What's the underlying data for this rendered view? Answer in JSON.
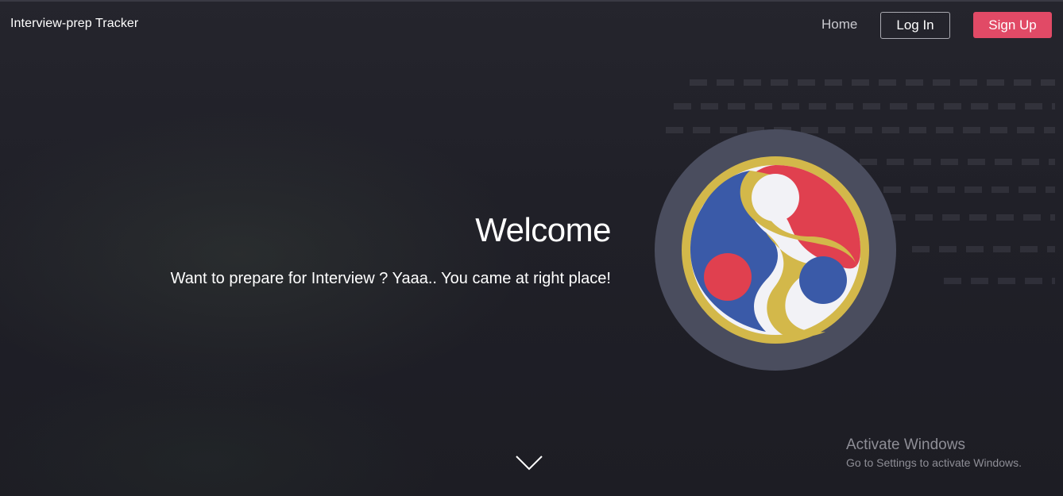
{
  "navbar": {
    "brand": "Interview-prep Tracker",
    "home_label": "Home",
    "login_label": "Log In",
    "signup_label": "Sign Up"
  },
  "hero": {
    "title": "Welcome",
    "tagline": "Want to prepare for Interview ? Yaaa.. You came at right place!",
    "logo_icon": "emblem-icon",
    "scroll_icon": "chevron-down-icon"
  },
  "watermark": {
    "title": "Activate Windows",
    "subtitle": "Go to Settings to activate Windows."
  },
  "colors": {
    "signup_bg": "#e14a66",
    "emblem_gold": "#d3b84a",
    "emblem_red": "#e0404f",
    "emblem_blue": "#3a5aa8",
    "emblem_white": "#f2f2f6",
    "emblem_ring": "#4a4d5e"
  }
}
